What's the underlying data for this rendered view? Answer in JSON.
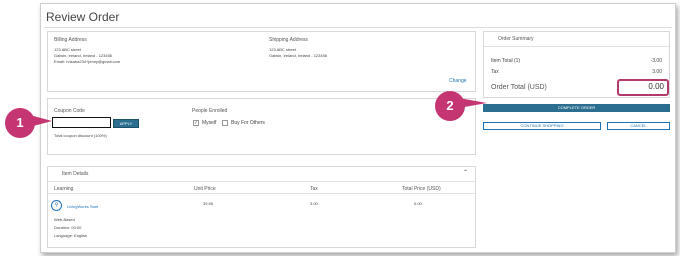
{
  "page": {
    "title": "Review Order"
  },
  "billing": {
    "heading": "Billing Address",
    "street": "123 ABC street",
    "city": "Galwin, Ireland, Ireland - 123456",
    "email": "Email: hrisaba234+jenny@gmail.com"
  },
  "shipping": {
    "heading": "Shipping Address",
    "street": "123 ABC street",
    "city": "Galwin, Ireland, Ireland - 123456"
  },
  "change_link": "Change",
  "coupon": {
    "label": "Coupon Code",
    "value": "",
    "apply_label": "APPLY",
    "discount_note": "Total coupon discount (100%)"
  },
  "people": {
    "heading": "People Enrolled",
    "myself_label": "Myself",
    "myself_checked": true,
    "others_label": "Buy For Others",
    "others_checked": false
  },
  "items": {
    "heading": "Item Details",
    "columns": [
      "Learning",
      "Unit Price",
      "Tax",
      "Total Price (USD)"
    ],
    "rows": [
      {
        "name": "LivingWorks Start",
        "unit_price": "39.95",
        "tax": "3.00",
        "total": "0.00",
        "type": "Web-Based",
        "duration": "Duration: 00:00",
        "language": "Language: English"
      }
    ]
  },
  "summary": {
    "heading": "Order Summary",
    "item_total_label": "Item Total (1)",
    "item_total_value": "-3.00",
    "tax_label": "Tax",
    "tax_value": "3.00",
    "order_total_label": "Order Total (USD)",
    "order_total_value": "0.00"
  },
  "actions": {
    "complete": "COMPLETE ORDER",
    "continue": "CONTINUE SHOPPING",
    "cancel": "CANCEL"
  },
  "callouts": [
    "1",
    "2"
  ],
  "colors": {
    "accent": "#2b6e8f",
    "callout": "#c53571",
    "link": "#1e73b8"
  }
}
